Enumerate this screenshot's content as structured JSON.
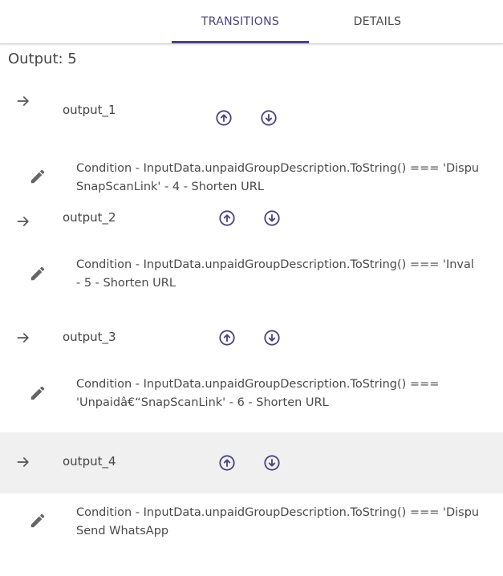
{
  "tabs": [
    {
      "label": "TRANSITIONS",
      "active": true
    },
    {
      "label": "DETAILS",
      "active": false
    }
  ],
  "output_title": "Output: 5",
  "colors": {
    "accent": "#4b4480",
    "highlight_row": "#f0f0f0"
  },
  "icons": {
    "row_arrow": "arrow-right-icon",
    "move_up": "arrow-circle-up-icon",
    "move_down": "arrow-circle-down-icon",
    "edit": "pencil-icon"
  },
  "outputs": [
    {
      "name": "output_1",
      "condition_line1": "Condition - InputData.unpaidGroupDescription.ToString() === 'Dispu",
      "condition_line2": "SnapScanLink' - 4 - Shorten URL"
    },
    {
      "name": "output_2",
      "condition_line1": "Condition - InputData.unpaidGroupDescription.ToString() === 'Inval",
      "condition_line2": "- 5 - Shorten URL"
    },
    {
      "name": "output_3",
      "condition_line1": "Condition - InputData.unpaidGroupDescription.ToString() ===",
      "condition_line2": "'Unpaidâ€“SnapScanLink' - 6 - Shorten URL"
    },
    {
      "name": "output_4",
      "highlighted": true,
      "condition_line1": "Condition - InputData.unpaidGroupDescription.ToString() === 'Dispu",
      "condition_line2": "Send WhatsApp"
    }
  ]
}
